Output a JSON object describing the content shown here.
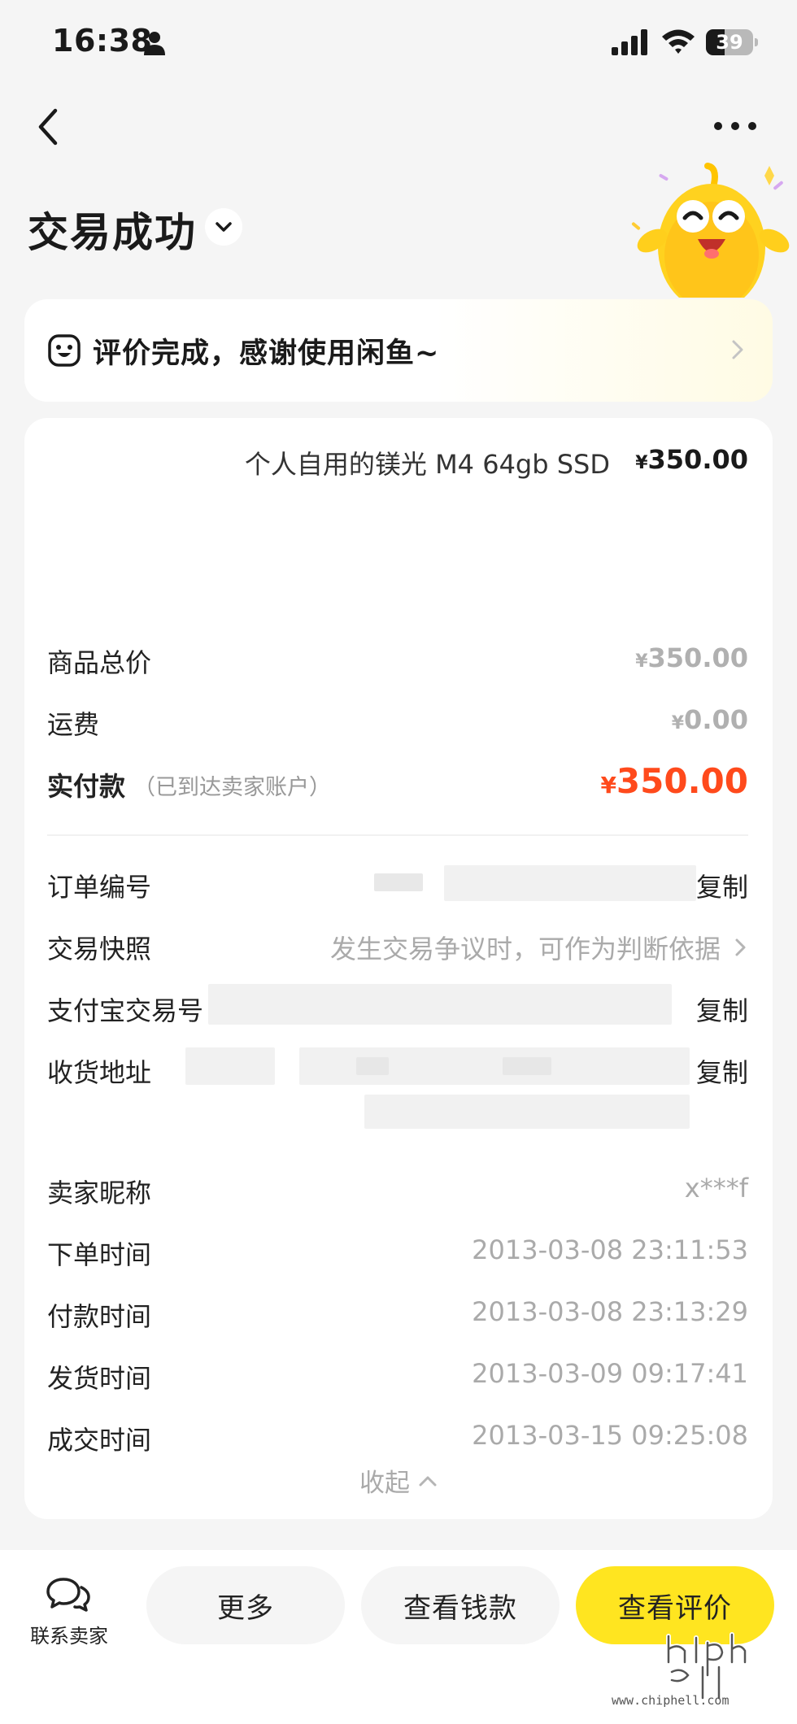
{
  "status_bar": {
    "time": "16:38",
    "battery": "39",
    "battery_level": 0.39
  },
  "nav": {
    "back_icon": "chevron-left-icon",
    "more_icon": "more-horizontal-icon"
  },
  "header": {
    "title": "交易成功"
  },
  "banner": {
    "text": "评价完成，感谢使用闲鱼~"
  },
  "product": {
    "name": "个人自用的镁光 M4 64gb SSD",
    "currency": "¥",
    "price": "350.00"
  },
  "price_summary": {
    "goods_total_label": "商品总价",
    "goods_total_value": "350.00",
    "shipping_label": "运费",
    "shipping_value": "0.00",
    "actual_paid_label": "实付款",
    "actual_paid_note": "（已到达卖家账户）",
    "actual_paid_value": "350.00",
    "currency": "¥"
  },
  "order_info": {
    "order_no_label": "订单编号",
    "snapshot_label": "交易快照",
    "snapshot_hint": "发生交易争议时，可作为判断依据",
    "alipay_no_label": "支付宝交易号",
    "address_label": "收货地址",
    "copy_label": "复制",
    "seller_label": "卖家昵称",
    "seller_value": "x***f",
    "order_time_label": "下单时间",
    "order_time_value": "2013-03-08 23:11:53",
    "pay_time_label": "付款时间",
    "pay_time_value": "2013-03-08 23:13:29",
    "ship_time_label": "发货时间",
    "ship_time_value": "2013-03-09 09:17:41",
    "deal_time_label": "成交时间",
    "deal_time_value": "2013-03-15 09:25:08",
    "collapse_label": "收起"
  },
  "bottom_bar": {
    "contact_label": "联系卖家",
    "more_label": "更多",
    "view_money_label": "查看钱款",
    "view_review_label": "查看评价"
  },
  "watermark": {
    "url": "www.chiphell.com"
  },
  "colors": {
    "accent_yellow": "#ffe520",
    "price_red": "#ff4a1c",
    "background": "#f5f5f5"
  }
}
